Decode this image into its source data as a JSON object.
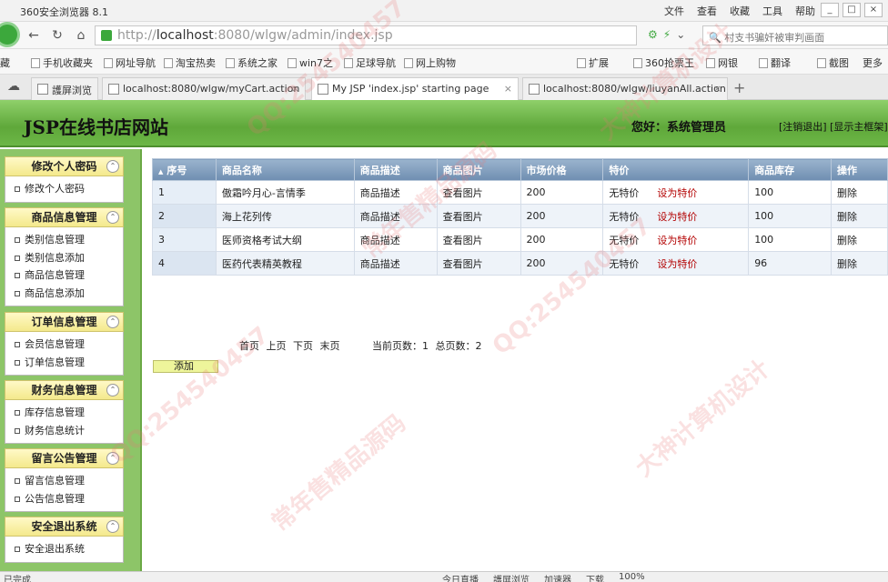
{
  "browser": {
    "title": "360安全浏览器 8.1",
    "sys_menu": [
      "文件",
      "查看",
      "收藏",
      "工具",
      "帮助"
    ],
    "url_prefix": "http://",
    "url_host": "localhost",
    "url_rest": ":8080/wlgw/admin/index.jsp",
    "search_text": "村支书骗奸被审判画面",
    "favorites": [
      "藏",
      "手机收藏夹",
      "网址导航",
      "淘宝热卖",
      "系统之家",
      "win7之",
      "足球导航",
      "网上购物",
      "扩展",
      "360抢票王",
      "网银",
      "翻译",
      "截图",
      "更多"
    ],
    "tabs": [
      {
        "label": "護屏浏览"
      },
      {
        "label": "localhost:8080/wlgw/myCart.action"
      },
      {
        "label": "My JSP 'index.jsp' starting page"
      },
      {
        "label": "localhost:8080/wlgw/liuyanAll.action"
      }
    ],
    "new_tab": "+"
  },
  "header": {
    "site_title": "JSP在线书店网站",
    "greeting": "您好：系统管理员",
    "links": "[注销退出]  [显示主框架]"
  },
  "sidebar": {
    "groups": [
      {
        "title": "修改个人密码",
        "items": [
          "修改个人密码"
        ]
      },
      {
        "title": "商品信息管理",
        "items": [
          "类别信息管理",
          "类别信息添加",
          "商品信息管理",
          "商品信息添加"
        ]
      },
      {
        "title": "订单信息管理",
        "items": [
          "会员信息管理",
          "订单信息管理"
        ]
      },
      {
        "title": "财务信息管理",
        "items": [
          "库存信息管理",
          "财务信息统计"
        ]
      },
      {
        "title": "留言公告管理",
        "items": [
          "留言信息管理",
          "公告信息管理"
        ]
      },
      {
        "title": "安全退出系统",
        "items": [
          "安全退出系统"
        ]
      }
    ],
    "collapse_glyph": "⌃"
  },
  "table": {
    "headers": [
      "序号",
      "商品名称",
      "商品描述",
      "商品图片",
      "市场价格",
      "特价",
      "商品库存",
      "操作"
    ],
    "sort_glyph": "▲",
    "rows": [
      {
        "idx": "1",
        "name": "傲霜吟月心-言情季",
        "desc": "商品描述",
        "img": "查看图片",
        "price": "200",
        "special": "无特价",
        "set_special": "设为特价",
        "stock": "100",
        "op": "删除"
      },
      {
        "idx": "2",
        "name": "海上花列传",
        "desc": "商品描述",
        "img": "查看图片",
        "price": "200",
        "special": "无特价",
        "set_special": "设为特价",
        "stock": "100",
        "op": "删除"
      },
      {
        "idx": "3",
        "name": "医师资格考试大纲",
        "desc": "商品描述",
        "img": "查看图片",
        "price": "200",
        "special": "无特价",
        "set_special": "设为特价",
        "stock": "100",
        "op": "删除"
      },
      {
        "idx": "4",
        "name": "医药代表精英教程",
        "desc": "商品描述",
        "img": "查看图片",
        "price": "200",
        "special": "无特价",
        "set_special": "设为特价",
        "stock": "96",
        "op": "删除"
      }
    ]
  },
  "pager": {
    "first": "首页",
    "prev": "上页",
    "next": "下页",
    "last": "末页",
    "current_label": "当前页数：1",
    "total_label": "总页数：2"
  },
  "add_button": "添加",
  "statusbar": {
    "left": "已完成",
    "items": [
      "今日直播",
      "護屏浏览",
      "加速器",
      "下载",
      "100%"
    ]
  },
  "watermarks": [
    "QQ:254540457",
    "大神计算机设计",
    "常年售精品源码"
  ]
}
